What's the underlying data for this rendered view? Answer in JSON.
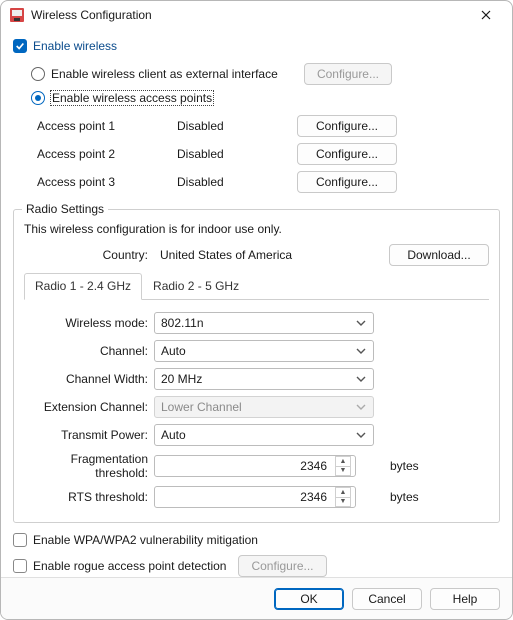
{
  "window": {
    "title": "Wireless Configuration"
  },
  "main": {
    "enable_wireless_label": "Enable wireless",
    "enable_wireless_checked": true,
    "mode_client_label": "Enable wireless client as external interface",
    "mode_client_selected": false,
    "mode_client_configure": "Configure...",
    "mode_ap_label": "Enable wireless access points",
    "mode_ap_selected": true
  },
  "access_points": [
    {
      "name": "Access point 1",
      "status": "Disabled",
      "button": "Configure..."
    },
    {
      "name": "Access point 2",
      "status": "Disabled",
      "button": "Configure..."
    },
    {
      "name": "Access point 3",
      "status": "Disabled",
      "button": "Configure..."
    }
  ],
  "radio": {
    "legend": "Radio Settings",
    "note": "This wireless configuration is for indoor use only.",
    "country_label": "Country:",
    "country_value": "United States of America",
    "download_button": "Download...",
    "tabs": [
      {
        "label": "Radio 1 - 2.4 GHz",
        "active": true
      },
      {
        "label": "Radio 2 - 5 GHz",
        "active": false
      }
    ],
    "fields": {
      "wireless_mode": {
        "label": "Wireless mode:",
        "value": "802.11n"
      },
      "channel": {
        "label": "Channel:",
        "value": "Auto"
      },
      "channel_width": {
        "label": "Channel Width:",
        "value": "20 MHz"
      },
      "extension_channel": {
        "label": "Extension Channel:",
        "value": "Lower Channel",
        "disabled": true
      },
      "transmit_power": {
        "label": "Transmit Power:",
        "value": "Auto"
      },
      "frag_threshold": {
        "label": "Fragmentation threshold:",
        "value": "2346",
        "unit": "bytes"
      },
      "rts_threshold": {
        "label": "RTS threshold:",
        "value": "2346",
        "unit": "bytes"
      }
    }
  },
  "options": {
    "wpa_mitigation_label": "Enable WPA/WPA2 vulnerability mitigation",
    "wpa_mitigation_checked": false,
    "rogue_detection_label": "Enable rogue access point detection",
    "rogue_detection_checked": false,
    "rogue_configure": "Configure..."
  },
  "footer": {
    "ok": "OK",
    "cancel": "Cancel",
    "help": "Help"
  }
}
